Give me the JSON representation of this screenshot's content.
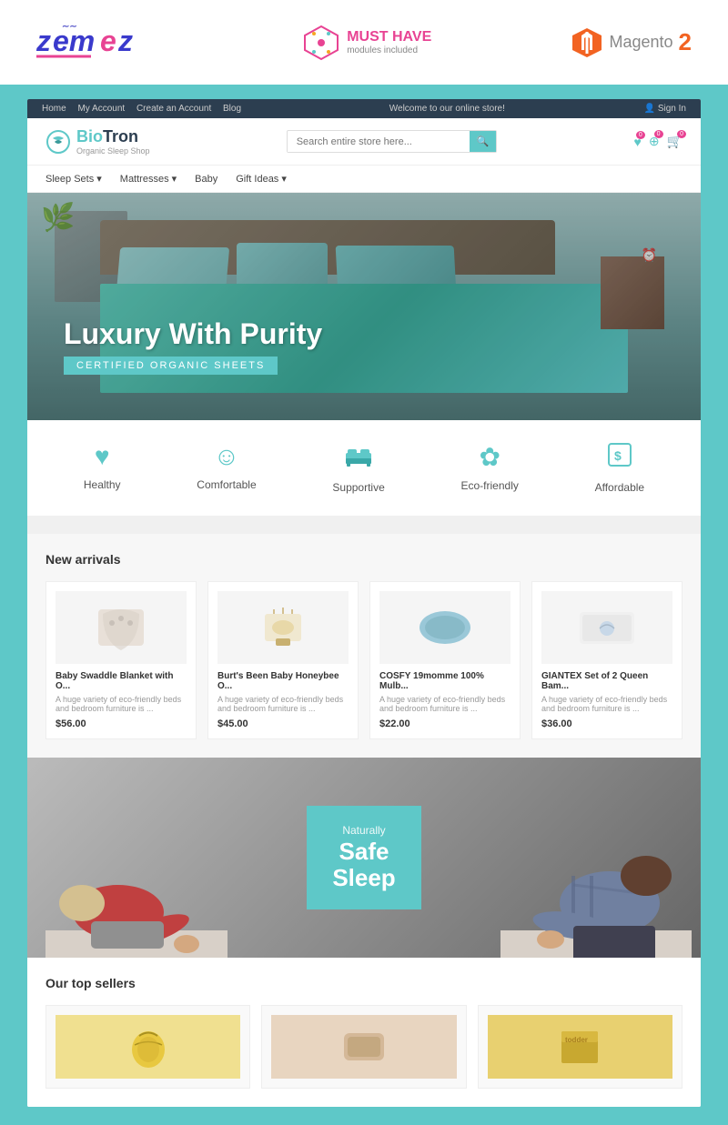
{
  "branding": {
    "zemes": {
      "part1": "zem",
      "part2": "e",
      "part3": "z"
    },
    "musthave": {
      "line1": "MUST HAVE",
      "line2": "modules included"
    },
    "magento": {
      "text": "Magento",
      "version": "2"
    }
  },
  "topnav": {
    "links": [
      "Home",
      "My Account",
      "Create an Account",
      "Blog"
    ],
    "center": "Welcome to our online store!",
    "signin": "Sign In"
  },
  "logo": {
    "bio": "Bio",
    "tron": "Tron",
    "subtitle": "Organic Sleep Shop"
  },
  "search": {
    "placeholder": "Search entire store here..."
  },
  "mainnav": {
    "items": [
      "Sleep Sets",
      "Mattresses",
      "Baby",
      "Gift Ideas"
    ]
  },
  "hero": {
    "title": "Luxury With Purity",
    "subtitle": "CERTIFIED ORGANIC SHEETS"
  },
  "features": [
    {
      "icon": "♥",
      "label": "Healthy"
    },
    {
      "icon": "☺",
      "label": "Comfortable"
    },
    {
      "icon": "🛏",
      "label": "Supportive"
    },
    {
      "icon": "✿",
      "label": "Eco-friendly"
    },
    {
      "icon": "💲",
      "label": "Affordable"
    }
  ],
  "new_arrivals": {
    "title": "New arrivals",
    "products": [
      {
        "name": "Baby Swaddle Blanket with O...",
        "desc": "A huge variety of eco-friendly beds and bedroom furniture is ...",
        "price": "$56.00",
        "emoji": "🧸"
      },
      {
        "name": "Burt's Been Baby Honeybee O...",
        "desc": "A huge variety of eco-friendly beds and bedroom furniture is ...",
        "price": "$45.00",
        "emoji": "🍯"
      },
      {
        "name": "COSFY 19momme 100% Mulb...",
        "desc": "A huge variety of eco-friendly beds and bedroom furniture is ...",
        "price": "$22.00",
        "emoji": "🛏"
      },
      {
        "name": "GIANTEX Set of 2 Queen Bam...",
        "desc": "A huge variety of eco-friendly beds and bedroom furniture is ...",
        "price": "$36.00",
        "emoji": "🌿"
      }
    ]
  },
  "safe_sleep": {
    "naturally": "Naturally",
    "safe": "Safe",
    "sleep": "Sleep"
  },
  "top_sellers": {
    "title": "Our top sellers",
    "products": [
      {
        "emoji": "🌽",
        "color": "#f5e6b0"
      },
      {
        "emoji": "🛏",
        "color": "#e8d5c0"
      },
      {
        "emoji": "📦",
        "color": "#e0c870"
      }
    ]
  }
}
